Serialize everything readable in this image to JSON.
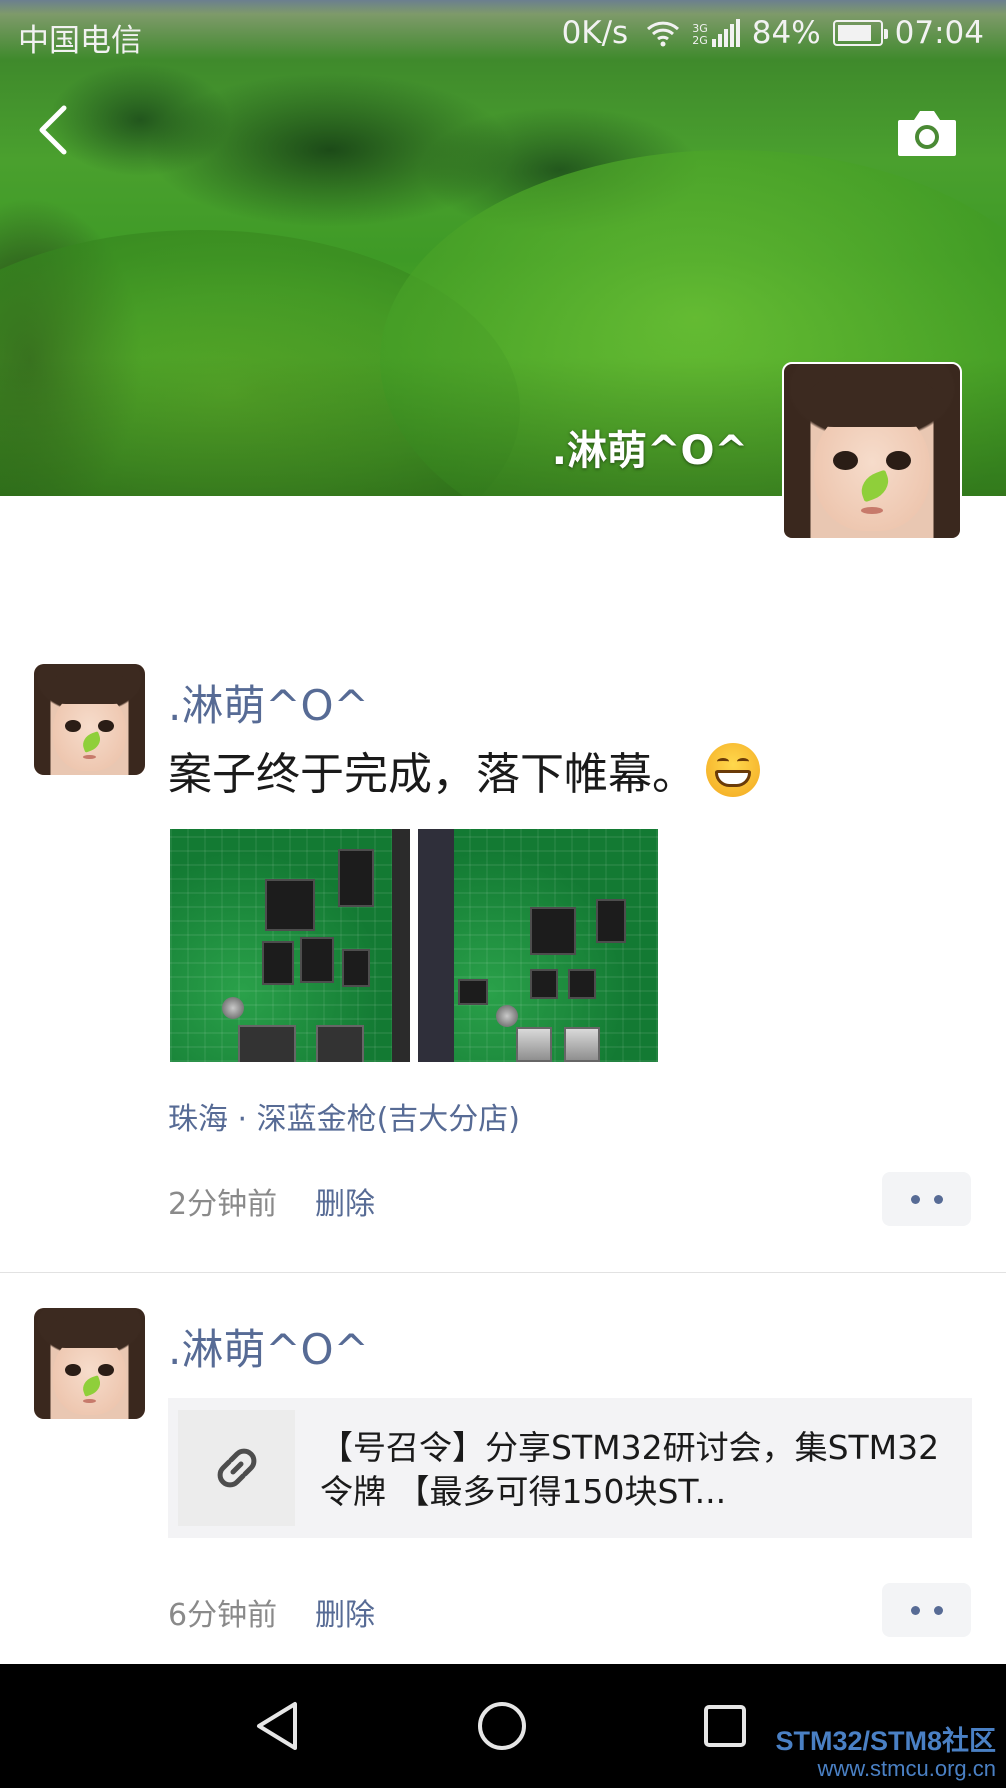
{
  "status_bar": {
    "carrier": "中国电信",
    "net_speed": "0K/s",
    "network_gen_top": "3G",
    "network_gen_bottom": "2G",
    "battery_percent": "84%",
    "battery_level": 0.84,
    "time": "07:04"
  },
  "header": {
    "back_icon": "chevron-left-icon",
    "camera_icon": "camera-icon",
    "user_name": ".淋萌^O^"
  },
  "posts": [
    {
      "author": ".淋萌^O^",
      "text": "案子终于完成，落下帷幕。",
      "emoji": "grinning-face-icon",
      "photo_count": 2,
      "location": "珠海 · 深蓝金枪(吉大分店)",
      "time": "2分钟前",
      "delete_label": "删除"
    },
    {
      "author": ".淋萌^O^",
      "link_icon": "link-icon",
      "link_title": "【号召令】分享STM32研讨会，集STM32令牌 【最多可得150块ST...",
      "time": "6分钟前",
      "delete_label": "删除"
    }
  ],
  "nav_bar": {
    "back": "triangle-back-icon",
    "home": "circle-home-icon",
    "recent": "square-recent-icon"
  },
  "watermark": {
    "line1": "STM32/STM8社区",
    "line2": "www.stmcu.org.cn"
  },
  "colors": {
    "link_blue": "#576b95",
    "meta_gray": "#8a8a8a",
    "card_bg": "#f3f3f5"
  }
}
